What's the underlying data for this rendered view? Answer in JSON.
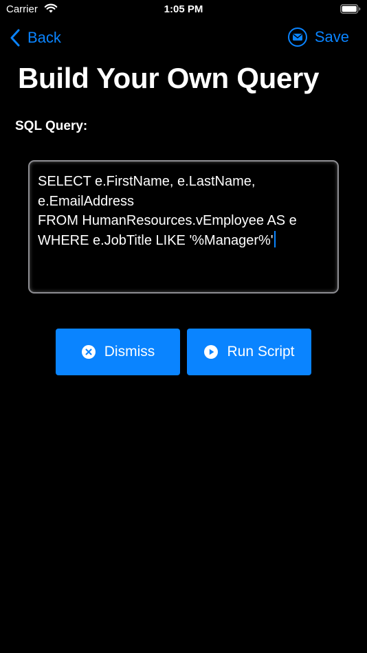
{
  "status_bar": {
    "carrier": "Carrier",
    "time": "1:05 PM"
  },
  "nav": {
    "back_label": "Back",
    "save_label": "Save"
  },
  "page": {
    "title": "Build Your Own Query",
    "section_label": "SQL Query:"
  },
  "query": {
    "text": "SELECT e.FirstName, e.LastName, e.EmailAddress\nFROM HumanResources.vEmployee AS e\nWHERE e.JobTitle LIKE '%Manager%'"
  },
  "actions": {
    "dismiss_label": "Dismiss",
    "run_label": "Run Script"
  },
  "colors": {
    "accent": "#0a84ff",
    "background": "#000000",
    "text": "#ffffff",
    "field_border": "#8e8e93"
  },
  "icons": {
    "back": "chevron-left-icon",
    "save": "envelope-icon",
    "dismiss": "x-circle-icon",
    "run": "play-circle-icon",
    "wifi": "wifi-icon",
    "battery": "battery-icon"
  }
}
